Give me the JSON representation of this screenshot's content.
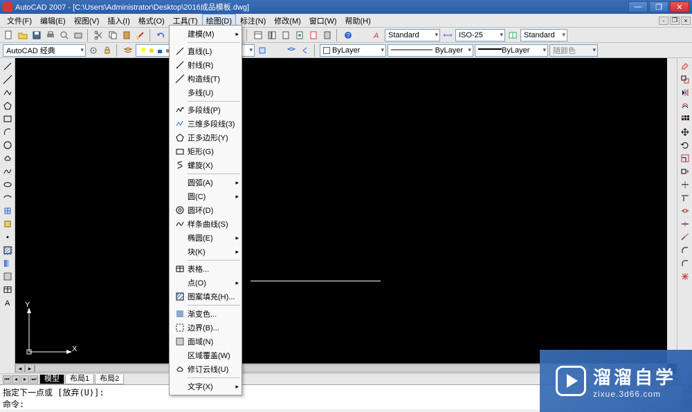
{
  "title": "AutoCAD 2007 - [C:\\Users\\Administrator\\Desktop\\2016成品模板.dwg]",
  "menubar": [
    "文件(F)",
    "编辑(E)",
    "视图(V)",
    "插入(I)",
    "格式(O)",
    "工具(T)",
    "绘图(D)",
    "标注(N)",
    "修改(M)",
    "窗口(W)",
    "帮助(H)"
  ],
  "activeMenuIndex": 6,
  "combo": {
    "style": "Standard",
    "dim": "ISO-25",
    "tbl": "Standard",
    "workspace": "AutoCAD 经典",
    "layercolor": "ByLayer",
    "linetype": "ByLayer",
    "lineweight": "ByLayer",
    "color": "随颜色"
  },
  "tabs": [
    "模型",
    "布局1",
    "布局2"
  ],
  "ucs": {
    "x": "X",
    "y": "Y"
  },
  "cmd": {
    "line1": "指定下一点或 [放弃(U)]:",
    "line2": "命令:"
  },
  "dropdown": [
    {
      "type": "item",
      "label": "建模(M)",
      "sub": true,
      "icon": ""
    },
    {
      "type": "sep"
    },
    {
      "type": "item",
      "label": "直线(L)",
      "icon": "line"
    },
    {
      "type": "item",
      "label": "射线(R)",
      "icon": "ray"
    },
    {
      "type": "item",
      "label": "构造线(T)",
      "icon": "xline"
    },
    {
      "type": "item",
      "label": "多线(U)",
      "icon": ""
    },
    {
      "type": "sep"
    },
    {
      "type": "item",
      "label": "多段线(P)",
      "icon": "pline"
    },
    {
      "type": "item",
      "label": "三维多段线(3)",
      "icon": "3dpoly"
    },
    {
      "type": "item",
      "label": "正多边形(Y)",
      "icon": "polygon"
    },
    {
      "type": "item",
      "label": "矩形(G)",
      "icon": "rect"
    },
    {
      "type": "item",
      "label": "螺旋(X)",
      "icon": "helix"
    },
    {
      "type": "sep"
    },
    {
      "type": "item",
      "label": "圆弧(A)",
      "sub": true,
      "icon": ""
    },
    {
      "type": "item",
      "label": "圆(C)",
      "sub": true,
      "icon": ""
    },
    {
      "type": "item",
      "label": "圆环(D)",
      "icon": "donut"
    },
    {
      "type": "item",
      "label": "样条曲线(S)",
      "icon": "spline"
    },
    {
      "type": "item",
      "label": "椭圆(E)",
      "sub": true,
      "icon": ""
    },
    {
      "type": "item",
      "label": "块(K)",
      "sub": true,
      "icon": ""
    },
    {
      "type": "sep"
    },
    {
      "type": "item",
      "label": "表格...",
      "icon": "table"
    },
    {
      "type": "item",
      "label": "点(O)",
      "sub": true,
      "icon": ""
    },
    {
      "type": "item",
      "label": "图案填充(H)...",
      "icon": "hatch"
    },
    {
      "type": "sep"
    },
    {
      "type": "item",
      "label": "渐变色...",
      "icon": "gradient"
    },
    {
      "type": "item",
      "label": "边界(B)...",
      "icon": "boundary"
    },
    {
      "type": "item",
      "label": "面域(N)",
      "icon": "region"
    },
    {
      "type": "item",
      "label": "区域覆盖(W)",
      "icon": ""
    },
    {
      "type": "item",
      "label": "修订云线(U)",
      "icon": "revcloud"
    },
    {
      "type": "sep"
    },
    {
      "type": "item",
      "label": "文字(X)",
      "sub": true,
      "icon": ""
    }
  ],
  "watermark": {
    "big": "溜溜自学",
    "small": "zixue.3d66.com"
  }
}
